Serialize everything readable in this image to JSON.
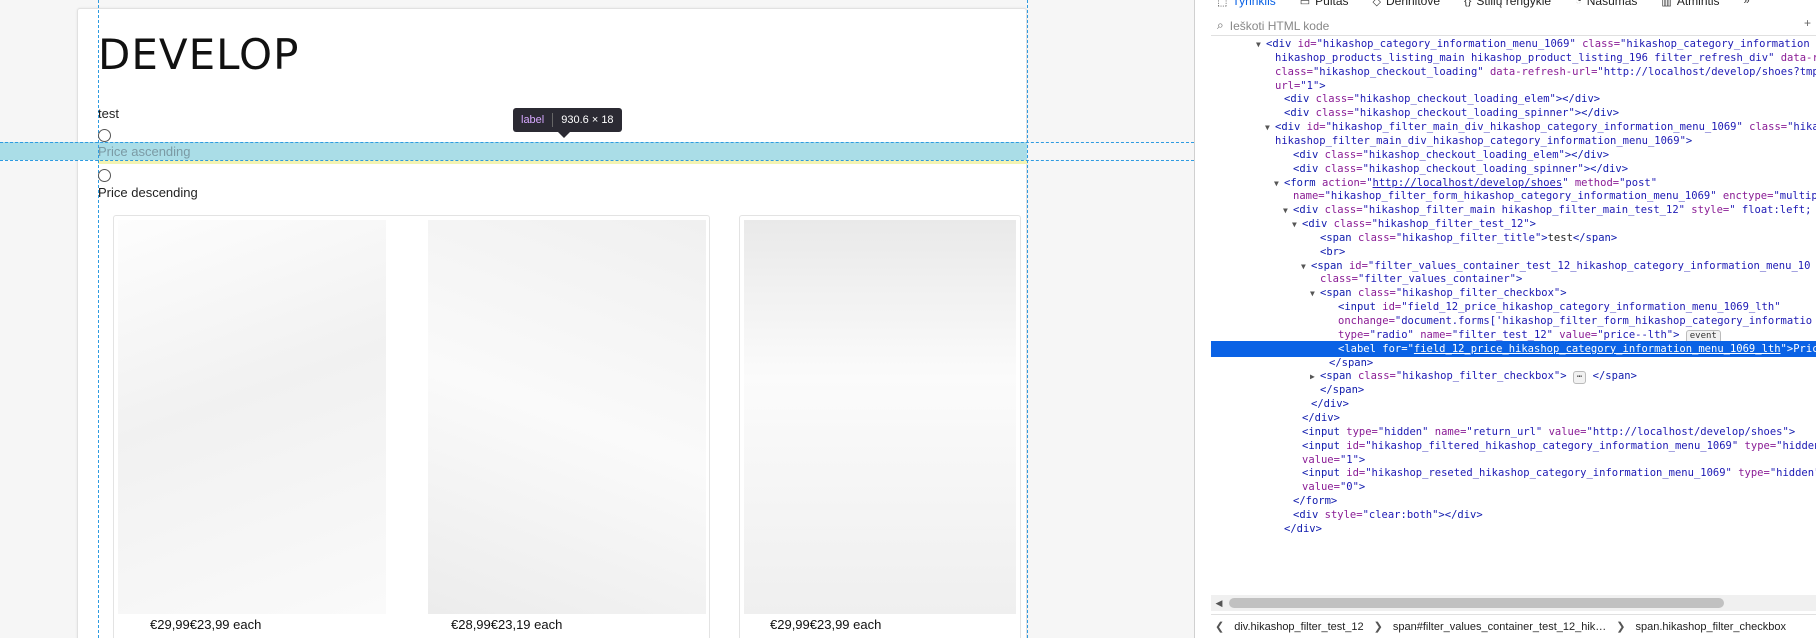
{
  "page": {
    "site_title": "DEVELOP",
    "filter_title": "test",
    "options": [
      {
        "label": "Price ascending",
        "selected": false
      },
      {
        "label": "Price descending",
        "selected": false
      }
    ],
    "products": [
      {
        "price": "€29,99€23,99 each"
      },
      {
        "price": "€28,99€23,19 each"
      },
      {
        "price": "€29,99€23,99 each"
      }
    ]
  },
  "tooltip": {
    "tag": "label",
    "size": "930.6 × 18"
  },
  "devtools": {
    "tabs": [
      {
        "label": "Tyrinklis",
        "icon": "inspector-icon"
      },
      {
        "label": "Pultas",
        "icon": "console-icon"
      },
      {
        "label": "Derinitove",
        "icon": "debugger-icon"
      },
      {
        "label": "Stilių rengyklė",
        "icon": "style-editor-icon"
      },
      {
        "label": "Našumas",
        "icon": "performance-icon"
      },
      {
        "label": "Atmintis",
        "icon": "memory-icon"
      }
    ],
    "search_placeholder": "Ieškoti HTML kode",
    "event_badge": "event",
    "ellipsis_badge": "⋯",
    "crumbs": [
      "div.hikashop_filter_test_12",
      "span#filter_values_container_test_12_hik…",
      "span.hikashop_filter_checkbox"
    ],
    "tree": [
      {
        "indent": 5,
        "tw": "▼",
        "html": "<span class=\"tag\">&lt;div</span> <span class=\"attr\">id=</span><span class=\"val\">\"hikashop_category_information_menu_1069\"</span> <span class=\"attr\">class=</span><span class=\"val\">\"hikashop_category_information</span>"
      },
      {
        "indent": 6,
        "tw": "",
        "html": "<span class=\"val\">hikashop_products_listing_main hikashop_product_listing_196 filter_refresh_div\"</span> <span class=\"attr\">data-refresh-</span>"
      },
      {
        "indent": 6,
        "tw": "",
        "html": "<span class=\"attr\">class=</span><span class=\"val\">\"hikashop_checkout_loading\"</span> <span class=\"attr\">data-refresh-url=</span><span class=\"val\">\"http://localhost/develop/shoes?tmpl=</span>"
      },
      {
        "indent": 6,
        "tw": "",
        "html": "<span class=\"attr\">url=</span><span class=\"val\">\"1\"</span><span class=\"tag\">&gt;</span>"
      },
      {
        "indent": 7,
        "tw": "",
        "html": "<span class=\"tag\">&lt;div</span> <span class=\"attr\">class=</span><span class=\"val\">\"hikashop_checkout_loading_elem\"</span><span class=\"tag\">&gt;&lt;/div&gt;</span>"
      },
      {
        "indent": 7,
        "tw": "",
        "html": "<span class=\"tag\">&lt;div</span> <span class=\"attr\">class=</span><span class=\"val\">\"hikashop_checkout_loading_spinner\"</span><span class=\"tag\">&gt;&lt;/div&gt;</span>"
      },
      {
        "indent": 6,
        "tw": "▼",
        "html": "<span class=\"tag\">&lt;div</span> <span class=\"attr\">id=</span><span class=\"val\">\"hikashop_filter_main_div_hikashop_category_information_menu_1069\"</span> <span class=\"attr\">class=</span><span class=\"val\">\"hika</span>"
      },
      {
        "indent": 6,
        "tw": "",
        "html": "<span class=\"val\">hikashop_filter_main_div_hikashop_category_information_menu_1069\"</span><span class=\"tag\">&gt;</span>"
      },
      {
        "indent": 8,
        "tw": "",
        "html": "<span class=\"tag\">&lt;div</span> <span class=\"attr\">class=</span><span class=\"val\">\"hikashop_checkout_loading_elem\"</span><span class=\"tag\">&gt;&lt;/div&gt;</span>"
      },
      {
        "indent": 8,
        "tw": "",
        "html": "<span class=\"tag\">&lt;div</span> <span class=\"attr\">class=</span><span class=\"val\">\"hikashop_checkout_loading_spinner\"</span><span class=\"tag\">&gt;&lt;/div&gt;</span>"
      },
      {
        "indent": 7,
        "tw": "▼",
        "html": "<span class=\"tag\">&lt;form</span> <span class=\"attr\">action=</span><span class=\"val\">\"</span><span class=\"link\">http://localhost/develop/shoes</span><span class=\"val\">\"</span> <span class=\"attr\">method=</span><span class=\"val\">\"post\"</span>"
      },
      {
        "indent": 8,
        "tw": "",
        "html": "<span class=\"attr\">name=</span><span class=\"val\">\"hikashop_filter_form_hikashop_category_information_menu_1069\"</span> <span class=\"attr\">enctype=</span><span class=\"val\">\"multipart</span>"
      },
      {
        "indent": 8,
        "tw": "▼",
        "html": "<span class=\"tag\">&lt;div</span> <span class=\"attr\">class=</span><span class=\"val\">\"hikashop_filter_main hikashop_filter_main_test_12\"</span> <span class=\"attr\">style=</span><span class=\"val\">\" float:left;</span>"
      },
      {
        "indent": 9,
        "tw": "▼",
        "html": "<span class=\"tag\">&lt;div</span> <span class=\"attr\">class=</span><span class=\"val\">\"hikashop_filter_test_12\"</span><span class=\"tag\">&gt;</span>"
      },
      {
        "indent": 11,
        "tw": "",
        "html": "<span class=\"tag\">&lt;span</span> <span class=\"attr\">class=</span><span class=\"val\">\"hikashop_filter_title\"</span><span class=\"tag\">&gt;</span>test<span class=\"tag\">&lt;/span&gt;</span>"
      },
      {
        "indent": 11,
        "tw": "",
        "html": "<span class=\"tag\">&lt;br&gt;</span>"
      },
      {
        "indent": 10,
        "tw": "▼",
        "html": "<span class=\"tag\">&lt;span</span> <span class=\"attr\">id=</span><span class=\"val\">\"filter_values_container_test_12_hikashop_category_information_menu_10</span>"
      },
      {
        "indent": 11,
        "tw": "",
        "html": "<span class=\"attr\">class=</span><span class=\"val\">\"filter_values_container\"</span><span class=\"tag\">&gt;</span>"
      },
      {
        "indent": 11,
        "tw": "▼",
        "html": "<span class=\"tag\">&lt;span</span> <span class=\"attr\">class=</span><span class=\"val\">\"hikashop_filter_checkbox\"</span><span class=\"tag\">&gt;</span>"
      },
      {
        "indent": 13,
        "tw": "",
        "html": "<span class=\"tag\">&lt;input</span> <span class=\"attr\">id=</span><span class=\"val\">\"field_12_price_hikashop_category_information_menu_1069_lth\"</span>"
      },
      {
        "indent": 13,
        "tw": "",
        "html": "<span class=\"attr\">onchange=</span><span class=\"val\">\"document.forms['hikashop_filter_form_hikashop_category_informatio</span>"
      },
      {
        "indent": 13,
        "tw": "",
        "html": "<span class=\"attr\">type=</span><span class=\"val\">\"radio\"</span> <span class=\"attr\">name=</span><span class=\"val\">\"filter_test_12\"</span> <span class=\"attr\">value=</span><span class=\"val\">\"price--lth\"</span><span class=\"tag\">&gt;</span> <span class=\"badge\" data-name=\"event-badge\">event</span>",
        "sel": false
      },
      {
        "indent": 13,
        "tw": "",
        "html": "<span class=\"tag\">&lt;label</span> <span class=\"attr\">for=</span><span class=\"val\">\"</span><span class=\"link\">field_12_price_hikashop_category_information_menu_1069_lth</span><span class=\"val\">\"</span><span class=\"tag\">&gt;</span>Pric",
        "sel": true
      },
      {
        "indent": 12,
        "tw": "",
        "html": "<span class=\"tag\">&lt;/span&gt;</span>"
      },
      {
        "indent": 11,
        "tw": "▶",
        "html": "<span class=\"tag\">&lt;span</span> <span class=\"attr\">class=</span><span class=\"val\">\"hikashop_filter_checkbox\"</span><span class=\"tag\">&gt;</span> <span class=\"badge\">⋯</span> <span class=\"tag\">&lt;/span&gt;</span>"
      },
      {
        "indent": 11,
        "tw": "",
        "html": "<span class=\"tag\">&lt;/span&gt;</span>"
      },
      {
        "indent": 10,
        "tw": "",
        "html": "<span class=\"tag\">&lt;/div&gt;</span>"
      },
      {
        "indent": 9,
        "tw": "",
        "html": "<span class=\"tag\">&lt;/div&gt;</span>"
      },
      {
        "indent": 9,
        "tw": "",
        "html": "<span class=\"tag\">&lt;input</span> <span class=\"attr\">type=</span><span class=\"val\">\"hidden\"</span> <span class=\"attr\">name=</span><span class=\"val\">\"return_url\"</span> <span class=\"attr\">value=</span><span class=\"val\">\"http://localhost/develop/shoes\"</span><span class=\"tag\">&gt;</span>"
      },
      {
        "indent": 9,
        "tw": "",
        "html": "<span class=\"tag\">&lt;input</span> <span class=\"attr\">id=</span><span class=\"val\">\"hikashop_filtered_hikashop_category_information_menu_1069\"</span> <span class=\"attr\">type=</span><span class=\"val\">\"hidden\"</span>"
      },
      {
        "indent": 9,
        "tw": "",
        "html": "<span class=\"attr\">value=</span><span class=\"val\">\"1\"</span><span class=\"tag\">&gt;</span>"
      },
      {
        "indent": 9,
        "tw": "",
        "html": "<span class=\"tag\">&lt;input</span> <span class=\"attr\">id=</span><span class=\"val\">\"hikashop_reseted_hikashop_category_information_menu_1069\"</span> <span class=\"attr\">type=</span><span class=\"val\">\"hidden\"</span>"
      },
      {
        "indent": 9,
        "tw": "",
        "html": "<span class=\"attr\">value=</span><span class=\"val\">\"0\"</span><span class=\"tag\">&gt;</span>"
      },
      {
        "indent": 8,
        "tw": "",
        "html": "<span class=\"tag\">&lt;/form&gt;</span>"
      },
      {
        "indent": 8,
        "tw": "",
        "html": "<span class=\"tag\">&lt;div</span> <span class=\"attr\">style=</span><span class=\"val\">\"clear:both\"</span><span class=\"tag\">&gt;&lt;/div&gt;</span>"
      },
      {
        "indent": 7,
        "tw": "",
        "html": "<span class=\"tag\">&lt;/div&gt;</span>"
      }
    ]
  }
}
